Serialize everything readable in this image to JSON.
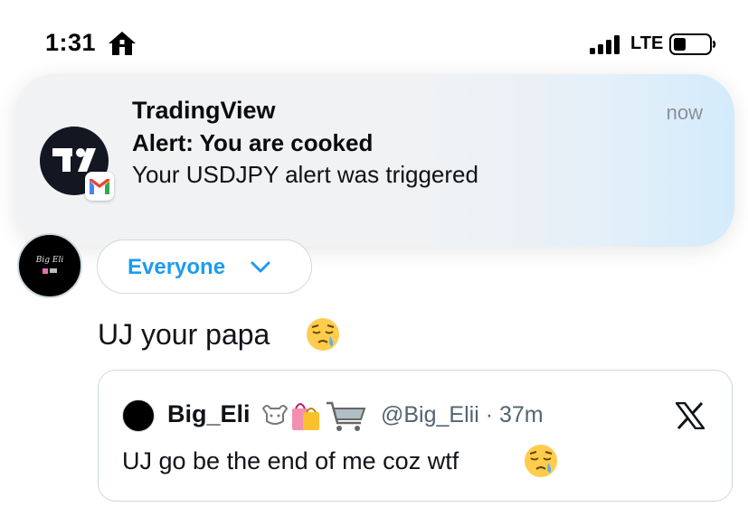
{
  "status_bar": {
    "time": "1:31",
    "network": "LTE"
  },
  "notification": {
    "app_name": "TradingView",
    "time": "now",
    "title": "Alert: You are cooked",
    "body": "Your USDJPY alert was triggered",
    "app_icon": "tradingview-logo",
    "badge_icon": "gmail-icon"
  },
  "compose": {
    "avatar_text": "Big Eli",
    "audience_label": "Everyone",
    "post_text": "UJ your papa",
    "post_emoji": "sleepy-face-emoji"
  },
  "quote": {
    "author_name": "Big_Eli",
    "name_emojis": [
      "bull-icon",
      "shopping-bags-emoji",
      "shopping-cart-emoji"
    ],
    "handle_time": "@Big_Elii · 37m",
    "text": "UJ go be the end of me coz wtf",
    "text_emoji": "sleepy-face-emoji"
  },
  "colors": {
    "accent_blue": "#1d9bf0",
    "text_primary": "#0f1419",
    "text_secondary": "#536471",
    "border": "#cfd9de",
    "tradingview_dark": "#131722"
  }
}
